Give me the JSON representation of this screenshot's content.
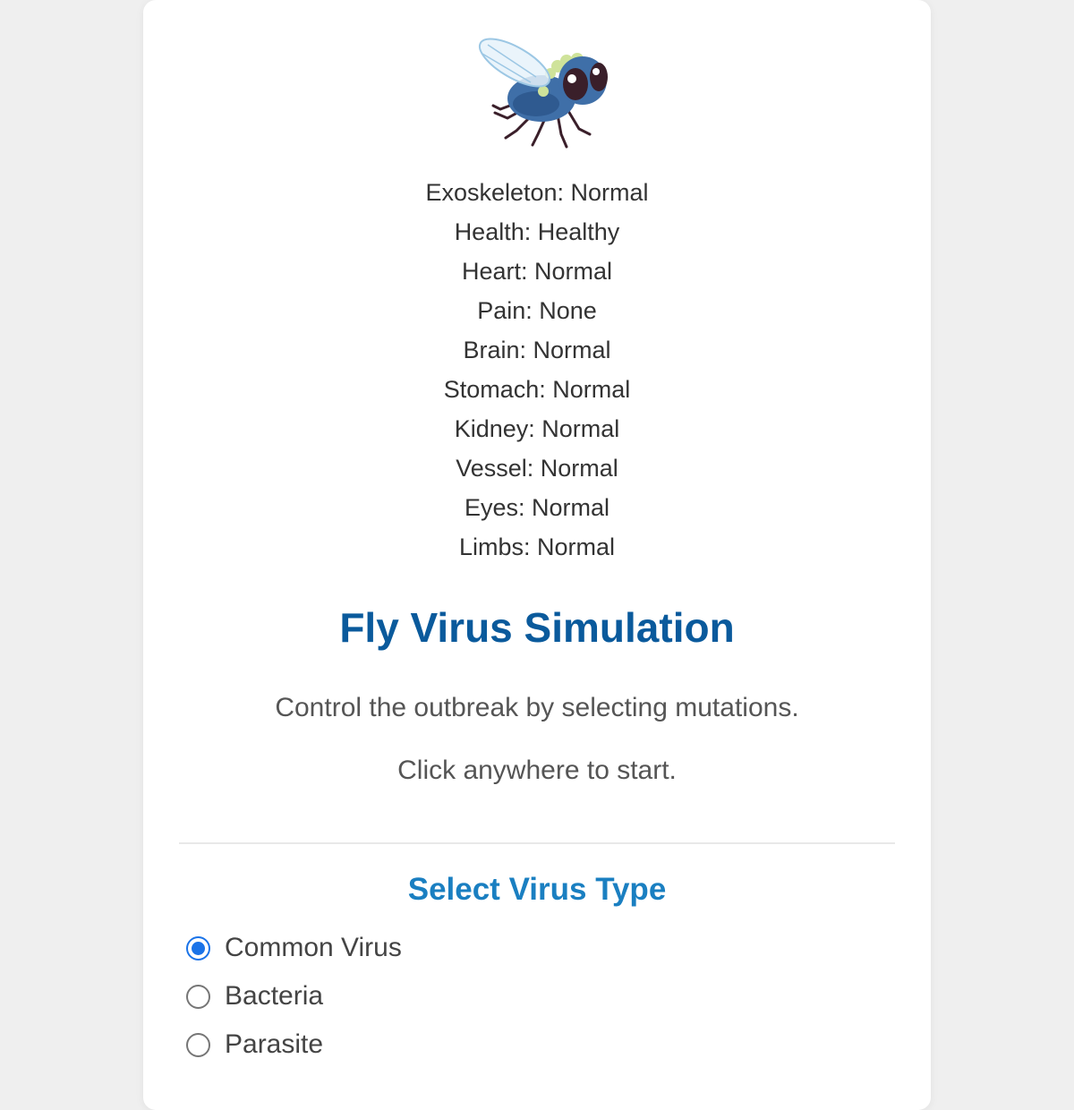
{
  "fly": {
    "image": "fly-illustration",
    "body_color": "#3f6fa8",
    "fuzz_color": "#cfe39a"
  },
  "stats": [
    {
      "label": "Exoskeleton",
      "value": "Normal"
    },
    {
      "label": "Health",
      "value": "Healthy"
    },
    {
      "label": "Heart",
      "value": "Normal"
    },
    {
      "label": "Pain",
      "value": "None"
    },
    {
      "label": "Brain",
      "value": "Normal"
    },
    {
      "label": "Stomach",
      "value": "Normal"
    },
    {
      "label": "Kidney",
      "value": "Normal"
    },
    {
      "label": "Vessel",
      "value": "Normal"
    },
    {
      "label": "Eyes",
      "value": "Normal"
    },
    {
      "label": "Limbs",
      "value": "Normal"
    }
  ],
  "title": "Fly Virus Simulation",
  "subtitle": "Control the outbreak by selecting mutations.",
  "instruction": "Click anywhere to start.",
  "virus_type": {
    "heading": "Select Virus Type",
    "options": [
      {
        "label": "Common Virus",
        "selected": true
      },
      {
        "label": "Bacteria",
        "selected": false
      },
      {
        "label": "Parasite",
        "selected": false
      }
    ]
  },
  "colors": {
    "title": "#0a5a9c",
    "section_title": "#1a7fc1",
    "radio_accent": "#1a73e8",
    "background": "#efefef"
  }
}
